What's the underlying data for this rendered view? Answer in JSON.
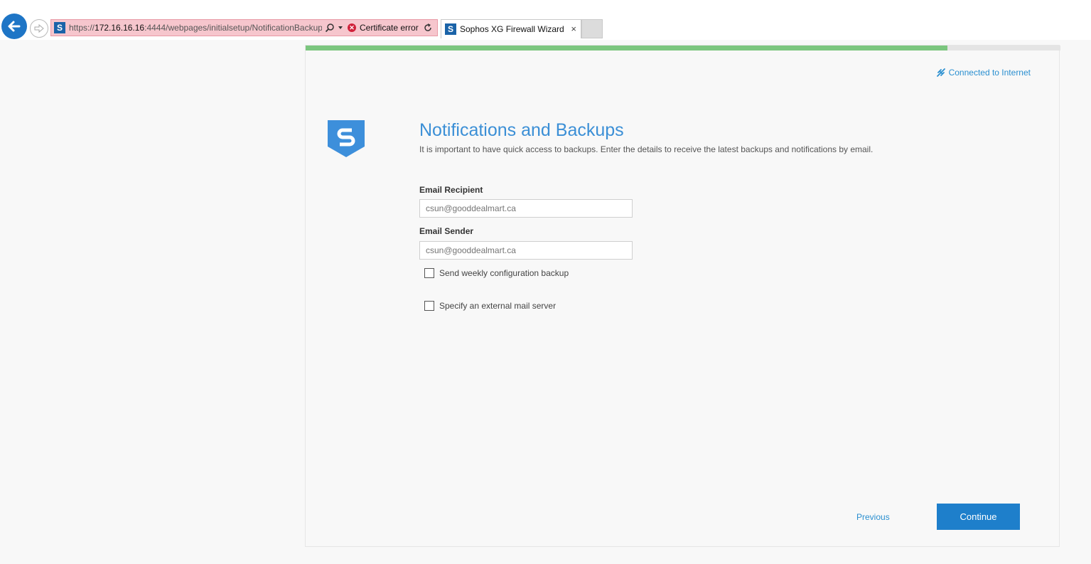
{
  "browser": {
    "url_prefix": "https://",
    "url_host": "172.16.16.16",
    "url_rest": ":4444/webpages/initialsetup/NotificationBackup",
    "cert_error": "Certificate error",
    "tab_title": "Sophos XG Firewall Wizard",
    "site_icon_letter": "S",
    "tab_close": "×"
  },
  "wizard": {
    "progress_fraction": 0.85,
    "connection_status": "Connected to Internet",
    "title": "Notifications and Backups",
    "subtitle": "It is important to have quick access to backups. Enter the details to receive the latest backups and notifications by email.",
    "email_recipient_label": "Email Recipient",
    "email_recipient_placeholder": "csun@gooddealmart.ca",
    "email_sender_label": "Email Sender",
    "email_sender_placeholder": "csun@gooddealmart.ca",
    "weekly_backup_label": "Send weekly configuration backup",
    "external_mail_label": "Specify an external mail server",
    "previous_label": "Previous",
    "continue_label": "Continue"
  },
  "colors": {
    "accent": "#1e7fcb",
    "progress": "#7bc67e",
    "address_bar_error": "#f6c6cd"
  },
  "icons": [
    "back-arrow-icon",
    "forward-arrow-icon",
    "search-icon",
    "dropdown-arrow-icon",
    "certificate-error-icon",
    "refresh-icon",
    "connection-icon",
    "sophos-shield-logo"
  ]
}
